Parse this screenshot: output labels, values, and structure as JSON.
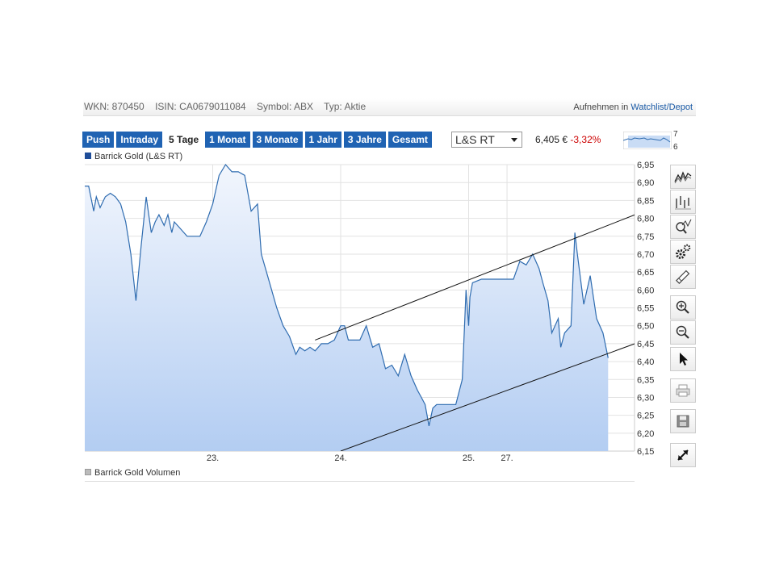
{
  "info": {
    "wkn": "WKN: 870450",
    "isin": "ISIN: CA0679011084",
    "symbol": "Symbol: ABX",
    "typ": "Typ: Aktie",
    "watch_prefix": "Aufnehmen in",
    "watch_link": "Watchlist/Depot"
  },
  "tabs": [
    {
      "label": "Push"
    },
    {
      "label": "Intraday"
    },
    {
      "label": "5 Tage",
      "active": true
    },
    {
      "label": "1 Monat"
    },
    {
      "label": "3 Monate"
    },
    {
      "label": "1 Jahr"
    },
    {
      "label": "3 Jahre"
    },
    {
      "label": "Gesamt"
    }
  ],
  "exchange": {
    "selected": "L&S RT"
  },
  "price": {
    "value": "6,405 €",
    "change": "-3,32%"
  },
  "mini_chart": {
    "top_label": "7",
    "bottom_label": "6"
  },
  "legend": {
    "main": "Barrick Gold (L&S RT)",
    "volume": "Barrick Gold Volumen"
  },
  "tools": [
    {
      "name": "line-chart-icon"
    },
    {
      "name": "ohlc-chart-icon"
    },
    {
      "name": "indicator-icon"
    },
    {
      "name": "settings-icon"
    },
    {
      "name": "draw-pen-icon"
    },
    {
      "name": "zoom-in-icon"
    },
    {
      "name": "zoom-out-icon"
    },
    {
      "name": "cursor-icon"
    },
    {
      "name": "print-icon"
    },
    {
      "name": "save-icon"
    },
    {
      "name": "fullscreen-icon"
    }
  ],
  "colors": {
    "line": "#2f6cb0",
    "fill_top": "#f2f6fd",
    "fill_bottom": "#b3cdf2",
    "tab": "#2063b3",
    "negative": "#cc0000"
  },
  "chart_data": {
    "type": "area",
    "series": [
      {
        "name": "Barrick Gold (L&S RT)",
        "x": [
          0,
          0.03,
          0.07,
          0.09,
          0.12,
          0.16,
          0.2,
          0.24,
          0.28,
          0.32,
          0.36,
          0.4,
          0.44,
          0.48,
          0.52,
          0.55,
          0.58,
          0.62,
          0.65,
          0.68,
          0.7,
          0.75,
          0.8,
          0.85,
          0.9,
          0.95,
          1.0,
          1.05,
          1.1,
          1.15,
          1.2,
          1.25,
          1.3,
          1.35,
          1.38,
          1.42,
          1.5,
          1.55,
          1.6,
          1.65,
          1.68,
          1.72,
          1.76,
          1.8,
          1.85,
          1.9,
          1.95,
          2.0,
          2.03,
          2.06,
          2.1,
          2.15,
          2.2,
          2.25,
          2.3,
          2.35,
          2.4,
          2.45,
          2.5,
          2.55,
          2.6,
          2.63,
          2.66,
          2.69,
          2.72,
          2.75,
          2.8,
          2.85,
          2.9,
          2.95,
          2.98,
          3.0,
          3.01,
          3.03,
          3.1,
          3.2,
          3.3,
          3.32,
          3.35,
          3.4,
          3.45,
          3.5,
          3.55,
          3.58,
          3.62,
          3.65,
          3.7,
          3.72,
          3.75,
          3.8,
          3.83,
          3.85,
          3.9,
          3.95,
          4.0,
          4.05,
          4.09
        ],
        "values": [
          6.89,
          6.89,
          6.82,
          6.86,
          6.83,
          6.86,
          6.87,
          6.86,
          6.84,
          6.79,
          6.7,
          6.57,
          6.72,
          6.86,
          6.76,
          6.79,
          6.81,
          6.78,
          6.81,
          6.76,
          6.79,
          6.77,
          6.75,
          6.75,
          6.75,
          6.79,
          6.84,
          6.92,
          6.95,
          6.93,
          6.93,
          6.92,
          6.82,
          6.84,
          6.7,
          6.65,
          6.55,
          6.5,
          6.47,
          6.42,
          6.44,
          6.43,
          6.44,
          6.43,
          6.45,
          6.45,
          6.46,
          6.5,
          6.5,
          6.46,
          6.46,
          6.46,
          6.5,
          6.44,
          6.45,
          6.38,
          6.39,
          6.36,
          6.42,
          6.36,
          6.32,
          6.3,
          6.28,
          6.22,
          6.27,
          6.28,
          6.28,
          6.28,
          6.28,
          6.35,
          6.6,
          6.5,
          6.58,
          6.62,
          6.63,
          6.63,
          6.63,
          6.63,
          6.63,
          6.68,
          6.67,
          6.7,
          6.66,
          6.62,
          6.57,
          6.48,
          6.52,
          6.44,
          6.48,
          6.5,
          6.76,
          6.7,
          6.56,
          6.64,
          6.52,
          6.48,
          6.41
        ]
      }
    ],
    "x_ticks": [
      {
        "x": 1,
        "label": "23."
      },
      {
        "x": 2,
        "label": "24."
      },
      {
        "x": 3,
        "label": "25."
      },
      {
        "x": 3.3,
        "label": "27."
      }
    ],
    "y_ticks": [
      "6,15",
      "6,20",
      "6,25",
      "6,30",
      "6,35",
      "6,40",
      "6,45",
      "6,50",
      "6,55",
      "6,60",
      "6,65",
      "6,70",
      "6,75",
      "6,80",
      "6,85",
      "6,90",
      "6,95"
    ],
    "ylim": [
      6.15,
      6.95
    ],
    "xlim": [
      0,
      4.3
    ],
    "trendlines": [
      {
        "x1": 1.8,
        "y1": 6.46,
        "x2": 4.3,
        "y2": 6.81
      },
      {
        "x1": 2.0,
        "y1": 6.15,
        "x2": 4.3,
        "y2": 6.45
      }
    ],
    "grid": true,
    "y_axis_position": "right"
  }
}
